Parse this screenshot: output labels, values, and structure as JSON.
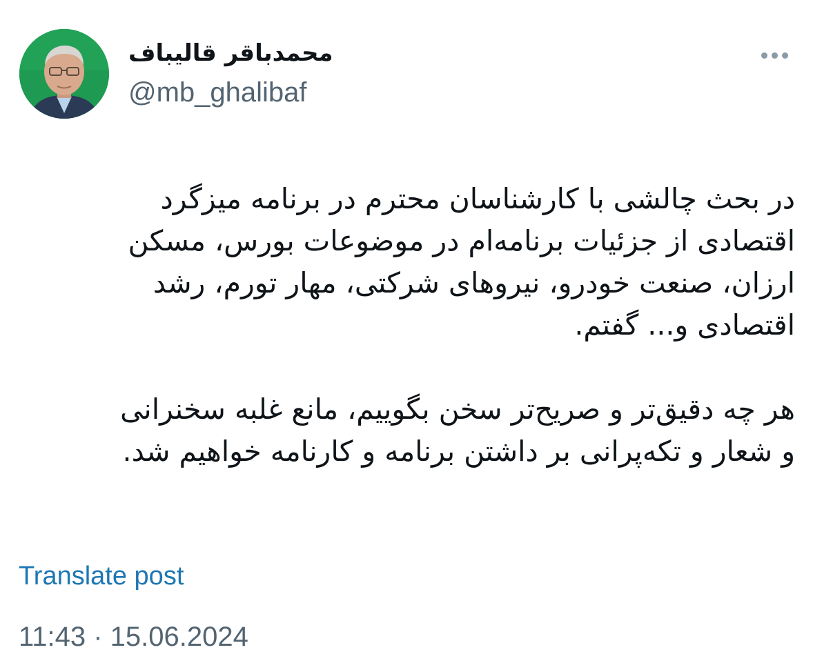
{
  "author": {
    "display_name": "محمدباقر قالیباف",
    "handle": "@mb_ghalibaf"
  },
  "post": {
    "paragraph_1": [
      "در بحث چالشی با کارشناسان محترم در برنامه میزگرد",
      "اقتصادی از جزئیات برنامه‌ام در موضوعات بورس، مسکن",
      "ارزان، صنعت خودرو، نیروهای شرکتی، مهار تورم، رشد",
      "اقتصادی و... گفتم."
    ],
    "paragraph_2": [
      "هر چه دقیق‌تر و صریح‌تر سخن بگوییم، مانع غلبه سخنرانی",
      "و شعار و تکه‌پرانی بر داشتن برنامه و کارنامه خواهیم شد."
    ],
    "translate_label": "Translate post",
    "timestamp": "11:43 · 15.06.2024"
  },
  "icons": {
    "more": "more-horizontal-icon"
  },
  "colors": {
    "text": "#0f1419",
    "secondary": "#536471",
    "link": "#1d77b4",
    "avatar_background": "#1f9a52"
  }
}
